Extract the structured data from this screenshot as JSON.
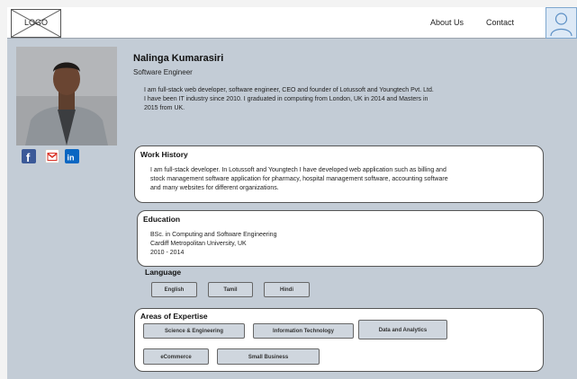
{
  "header": {
    "logo_text": "LOGO",
    "nav": [
      {
        "label": "About Us"
      },
      {
        "label": "Contact"
      }
    ],
    "avatar_icon": "user-avatar-icon"
  },
  "profile": {
    "name": "Nalinga Kumarasiri",
    "role": "Software Engineer",
    "bio_lines": [
      "I am full-stack web developer, software engineer, CEO and founder of Lotussoft and Youngtech Pvt. Ltd.",
      "I have been IT industry since 2010. I graduated in computing from London, UK in 2014 and Masters in",
      "2015 from UK."
    ],
    "social": [
      {
        "icon": "facebook-icon",
        "color": "#3b5998",
        "glyph": "f"
      },
      {
        "icon": "gmail-icon",
        "color": "#d93025",
        "glyph": "M"
      },
      {
        "icon": "linkedin-icon",
        "color": "#0a66c2",
        "glyph": "in"
      }
    ]
  },
  "work_history": {
    "title": "Work History",
    "lines": [
      "I am full-stack developer. In Lotussoft and Youngtech I have developed web application such as billing and",
      "stock management software application for pharmacy, hospital management software, accounting software",
      "and many websites for different organizations."
    ]
  },
  "education": {
    "title": "Education",
    "lines": [
      "BSc. in Computing and Software Engineering",
      "Cardiff Metropolitan University, UK",
      "2010 - 2014"
    ]
  },
  "language": {
    "title": "Language",
    "items": [
      "English",
      "Tamil",
      "Hindi"
    ]
  },
  "expertise": {
    "title": "Areas of Expertise",
    "items": [
      "Science & Engineering",
      "Information Technology",
      "Data and Analytics",
      "eCommerce",
      "Small Business"
    ]
  },
  "colors": {
    "page_background": "#c3ccd6",
    "card_background": "#ffffff",
    "pill_background": "#cfd6de"
  }
}
